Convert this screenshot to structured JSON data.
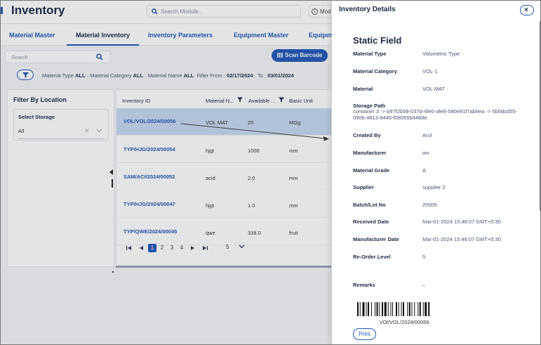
{
  "app": {
    "title": "Inventory"
  },
  "search_module": {
    "placeholder": "Search Module...",
    "mode_label": "Mod"
  },
  "tabs": [
    {
      "label": "Material Master"
    },
    {
      "label": "Material Inventory"
    },
    {
      "label": "Inventory Parameters"
    },
    {
      "label": "Equipment Master"
    },
    {
      "label": "Equipm"
    }
  ],
  "toolbar": {
    "search_placeholder": "Search",
    "scan_label": "Scan Barcode",
    "filter_summary": {
      "material_type_label": "Material Type",
      "material_type_value": "ALL",
      "material_category_label": "Material Category",
      "material_category_value": "ALL",
      "material_name_label": "Material Name",
      "material_name_value": "ALL",
      "filter_from_label": "Filter From :",
      "filter_from_value": "02/17/2024",
      "to_label": "To :",
      "to_value": "03/01/2024"
    }
  },
  "left_panel": {
    "title": "Filter By Location",
    "storage_label": "Select Storage",
    "storage_value": "All"
  },
  "table": {
    "columns": [
      "Inventory ID",
      "Material N...",
      "Available ...",
      "Basic Unit"
    ],
    "rows": [
      {
        "id": "VOL/VOL/2024/00056",
        "material": "VOL MAT",
        "available": "20",
        "unit": "MGg"
      },
      {
        "id": "TYP/HJG/2024/00054",
        "material": "hjgt",
        "available": "1000",
        "unit": "mm"
      },
      {
        "id": "SAM/ACI/2024/00052",
        "material": "acid",
        "available": "2.0",
        "unit": "mm"
      },
      {
        "id": "TYP/HJG/2024/00047",
        "material": "hjgt",
        "available": "1.0",
        "unit": "mm"
      },
      {
        "id": "TYP/QWE/2024/00045",
        "material": "qwe",
        "available": "338.0",
        "unit": "fruit"
      }
    ],
    "pager": {
      "pages": [
        "1",
        "2",
        "3",
        "4"
      ],
      "current": "1",
      "page_size": "5"
    }
  },
  "drawer": {
    "title": "Inventory Details",
    "section_title": "Static Field",
    "fields": [
      {
        "label": "Material Type",
        "value": "Volumetric Type"
      },
      {
        "label": "Material Category",
        "value": "VOL-1"
      },
      {
        "label": "Material",
        "value": "VOL MAT"
      },
      {
        "label": "Storage Path",
        "value": "container 3 -> b97f2b58-037d-4fe0-afe8-580e91f7ab9ea -> 5b0dcd55-090b-4813-8445-f08055b9489e"
      },
      {
        "label": "Created By",
        "value": "Arul"
      },
      {
        "label": "Manufacturer",
        "value": "wn"
      },
      {
        "label": "Material Grade",
        "value": "A"
      },
      {
        "label": "Supplier",
        "value": "supplier 2"
      },
      {
        "label": "Batch/Lot No",
        "value": "20005"
      },
      {
        "label": "Received Date",
        "value": "Mar-01-2024 15:48:07 GMT+5:30"
      },
      {
        "label": "Manufacturer Date",
        "value": "Mar-01-2024 15:48:07 GMT+5:30"
      },
      {
        "label": "Re-Order Level",
        "value": "5"
      },
      {
        "label": "Remarks",
        "value": "–"
      }
    ],
    "barcode_text": "VOl/VOL/2024/00056",
    "print_label": "Print",
    "close_label": "×"
  },
  "colors": {
    "accent": "#2358b8",
    "selected_row": "#c7d9f2",
    "text": "#1d2a44"
  }
}
